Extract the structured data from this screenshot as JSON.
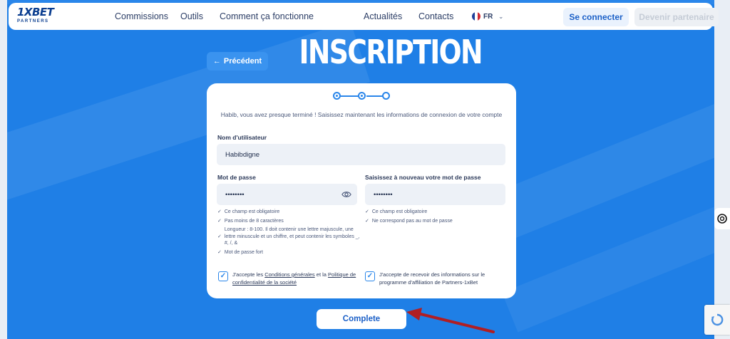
{
  "nav": {
    "logo_main": "1XBET",
    "logo_sub": "PARTNERS",
    "links": [
      "Commissions",
      "Outils",
      "Comment ça fonctionne",
      "Actualités",
      "Contacts"
    ],
    "lang": "FR",
    "login_label": "Se connecter",
    "partner_label": "Devenir partenaire"
  },
  "header": {
    "prev_label": "Précédent",
    "title": "INSCRIPTION"
  },
  "form": {
    "intro": "Habib, vous avez presque terminé ! Saisissez maintenant les informations de connexion de votre compte",
    "username_label": "Nom d'utilisateur",
    "username_value": "Habibdigne",
    "password_label": "Mot de passe",
    "password_value": "••••••••",
    "confirm_label": "Saisissez à nouveau votre mot de passe",
    "confirm_value": "••••••••",
    "password_rules": [
      "Ce champ est obligatoire",
      "Pas moins de 8 caractères",
      "Longueur : 8-100. Il doit contenir une lettre majuscule, une lettre minuscule et un chiffre, et peut contenir les symboles _, #, /, &",
      "Mot de passe fort"
    ],
    "confirm_rules": [
      "Ce champ est obligatoire",
      "Ne correspond pas au mot de passe"
    ],
    "agree1_prefix": "J'accepte les ",
    "agree1_link1": "Conditions générales",
    "agree1_mid": " et la ",
    "agree1_link2": "Politique de confidentialité de la société",
    "agree2": "J'accepte de recevoir des informations sur le programme d'affiliation de Partners-1xBet"
  },
  "complete_label": "Complete",
  "colors": {
    "background": "#1f7fe6",
    "accent": "#2a86ea",
    "arrow": "#b01e23"
  }
}
